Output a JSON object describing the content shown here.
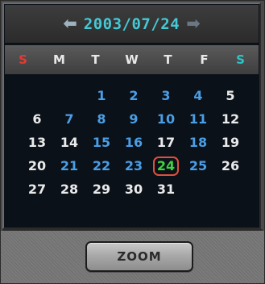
{
  "calendar": {
    "title": "2003/07/24",
    "prev_glyph": "⬅",
    "next_glyph": "➡",
    "weekdays": [
      {
        "label": "S",
        "color": "#e23b32"
      },
      {
        "label": "M",
        "color": "#e8e8e8"
      },
      {
        "label": "T",
        "color": "#e8e8e8"
      },
      {
        "label": "W",
        "color": "#e8e8e8"
      },
      {
        "label": "T",
        "color": "#e8e8e8"
      },
      {
        "label": "F",
        "color": "#e8e8e8"
      },
      {
        "label": "S",
        "color": "#2fc3c6"
      }
    ],
    "weeks": [
      [
        "",
        "",
        "1",
        "2",
        "3",
        "4",
        "5"
      ],
      [
        "6",
        "7",
        "8",
        "9",
        "10",
        "11",
        "12"
      ],
      [
        "13",
        "14",
        "15",
        "16",
        "17",
        "18",
        "19"
      ],
      [
        "20",
        "21",
        "22",
        "23",
        "24",
        "25",
        "26"
      ],
      [
        "27",
        "28",
        "29",
        "30",
        "31",
        "",
        ""
      ]
    ],
    "highlighted_days": [
      "1",
      "2",
      "3",
      "4",
      "7",
      "8",
      "9",
      "10",
      "11",
      "15",
      "16",
      "18",
      "21",
      "22",
      "23",
      "25"
    ],
    "selected_day": "24",
    "colors": {
      "title": "#44c9d6",
      "default_day": "#eaeaea",
      "highlight_day": "#4a9ee6",
      "selected_day": "#3fd33f",
      "selected_ring": "#e0503c"
    }
  },
  "zoom_button": {
    "label": "ZOOM"
  }
}
